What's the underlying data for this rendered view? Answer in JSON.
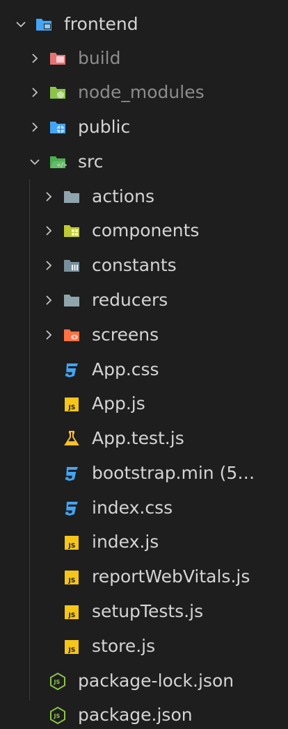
{
  "explorer": {
    "root": {
      "label": "frontend",
      "icon": "folder-frontend-open-icon"
    },
    "items": [
      {
        "label": "build",
        "icon": "folder-build-icon",
        "expanded": false
      },
      {
        "label": "node_modules",
        "icon": "folder-node-icon",
        "expanded": false
      },
      {
        "label": "public",
        "icon": "folder-public-icon",
        "expanded": false
      },
      {
        "label": "src",
        "icon": "folder-src-open-icon",
        "expanded": true
      },
      {
        "label": "actions",
        "icon": "folder-gray-icon",
        "expanded": false
      },
      {
        "label": "components",
        "icon": "folder-components-icon",
        "expanded": false
      },
      {
        "label": "constants",
        "icon": "folder-constants-icon",
        "expanded": false
      },
      {
        "label": "reducers",
        "icon": "folder-gray-icon",
        "expanded": false
      },
      {
        "label": "screens",
        "icon": "folder-screens-icon",
        "expanded": false
      },
      {
        "label": "App.css",
        "icon": "css-icon"
      },
      {
        "label": "App.js",
        "icon": "js-icon"
      },
      {
        "label": "App.test.js",
        "icon": "test-flask-icon"
      },
      {
        "label": "bootstrap.min (5)....",
        "icon": "css-icon"
      },
      {
        "label": "index.css",
        "icon": "css-icon"
      },
      {
        "label": "index.js",
        "icon": "js-icon"
      },
      {
        "label": "reportWebVitals.js",
        "icon": "js-icon"
      },
      {
        "label": "setupTests.js",
        "icon": "js-icon"
      },
      {
        "label": "store.js",
        "icon": "js-icon"
      },
      {
        "label": "package-lock.json",
        "icon": "nodejs-icon"
      },
      {
        "label": "package.json",
        "icon": "nodejs-icon"
      }
    ]
  },
  "colors": {
    "background": "#1e1e1e",
    "text": "#d4d4d4",
    "dim_text": "#8c8c8c",
    "css_blue": "#42a5f5",
    "js_yellow": "#f5c518",
    "node_green": "#8bc34a"
  }
}
